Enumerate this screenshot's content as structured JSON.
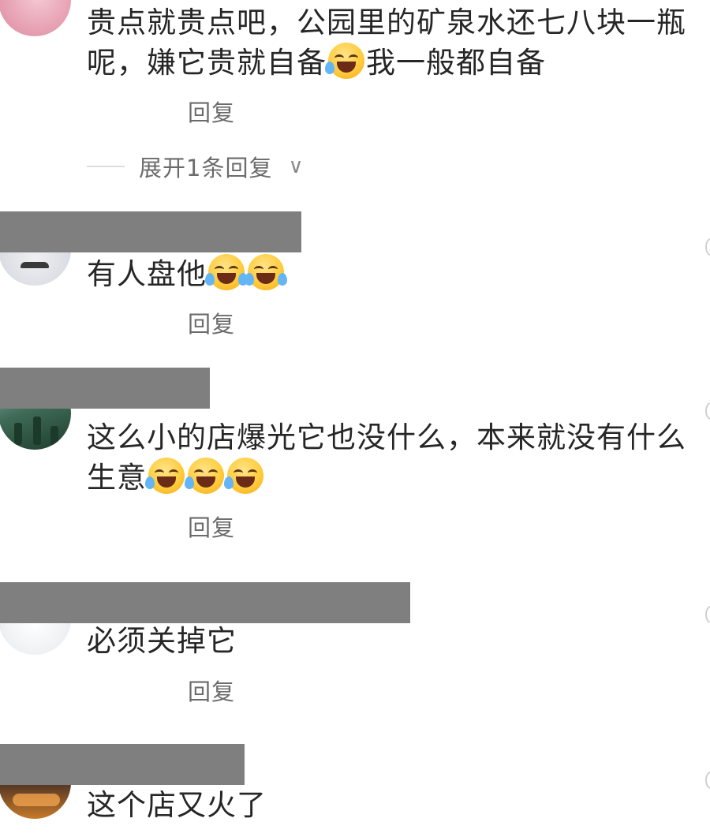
{
  "comments": [
    {
      "text_lines": [
        "贵点就贵点吧，公园里的矿泉水还七八块一瓶",
        "呢，嫌它贵就自备",
        "我一般都自备"
      ],
      "emoji_icon": "rofl-emoji",
      "reply_label": "回复",
      "expand_label": "展开1条回复"
    },
    {
      "text": "有人盘他",
      "emoji_icon": "joy-tears-emoji",
      "reply_label": "回复"
    },
    {
      "text_lines": [
        "这么小的店爆光它也没什么，本来就没有什么",
        "生意"
      ],
      "emoji_icon": "rofl-emoji",
      "reply_label": "回复"
    },
    {
      "text": "必须关掉它",
      "reply_label": "回复"
    },
    {
      "text": "这个店又火了"
    }
  ],
  "colors": {
    "text": "#262626",
    "reply": "#6b6b6b",
    "redaction_bar": "#7f7f7f"
  }
}
